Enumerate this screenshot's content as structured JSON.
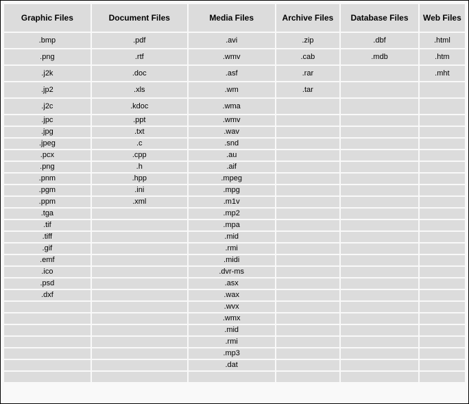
{
  "headers": [
    "Graphic Files",
    "Document Files",
    "Media Files",
    "Archive Files",
    "Database Files",
    "Web Files"
  ],
  "cols": {
    "graphic": [
      ".bmp",
      ".png",
      ".j2k",
      ".jp2",
      ".j2c",
      ".jpc",
      ".jpg",
      ".jpeg",
      ".pcx",
      ".png",
      ".pnm",
      ".pgm",
      ".ppm",
      ".tga",
      ".tif",
      ".tiff",
      ".gif",
      ".emf",
      ".ico",
      ".psd",
      ".dxf",
      "",
      "",
      "",
      "",
      "",
      "",
      ""
    ],
    "document": [
      ".pdf",
      ".rtf",
      ".doc",
      ".xls",
      ".kdoc",
      ".ppt",
      ".txt",
      ".c",
      ".cpp",
      ".h",
      ".hpp",
      ".ini",
      ".xml",
      "",
      "",
      "",
      "",
      "",
      "",
      "",
      "",
      "",
      "",
      "",
      "",
      "",
      "",
      ""
    ],
    "media": [
      ".avi",
      ".wmv",
      ".asf",
      ".wm",
      ".wma",
      ".wmv",
      ".wav",
      ".snd",
      ".au",
      ".aif",
      ".mpeg",
      ".mpg",
      ".m1v",
      ".mp2",
      ".mpa",
      ".mid",
      ".rmi",
      ".midi",
      ".dvr-ms",
      ".asx",
      ".wax",
      ".wvx",
      ".wmx",
      ".mid",
      ".rmi",
      ".mp3",
      ".dat",
      ""
    ],
    "archive": [
      ".zip",
      ".cab",
      ".rar",
      ".tar",
      "",
      "",
      "",
      "",
      "",
      "",
      "",
      "",
      "",
      "",
      "",
      "",
      "",
      "",
      "",
      "",
      "",
      "",
      "",
      "",
      "",
      "",
      "",
      ""
    ],
    "database": [
      ".dbf",
      ".mdb",
      "",
      "",
      "",
      "",
      "",
      "",
      "",
      "",
      "",
      "",
      "",
      "",
      "",
      "",
      "",
      "",
      "",
      "",
      "",
      "",
      "",
      "",
      "",
      "",
      "",
      ""
    ],
    "web": [
      ".html",
      ".htm",
      ".mht",
      "",
      "",
      "",
      "",
      "",
      "",
      "",
      "",
      "",
      "",
      "",
      "",
      "",
      "",
      "",
      "",
      "",
      "",
      "",
      "",
      "",
      "",
      "",
      "",
      ""
    ]
  },
  "tallRows": 5,
  "totalRows": 28
}
